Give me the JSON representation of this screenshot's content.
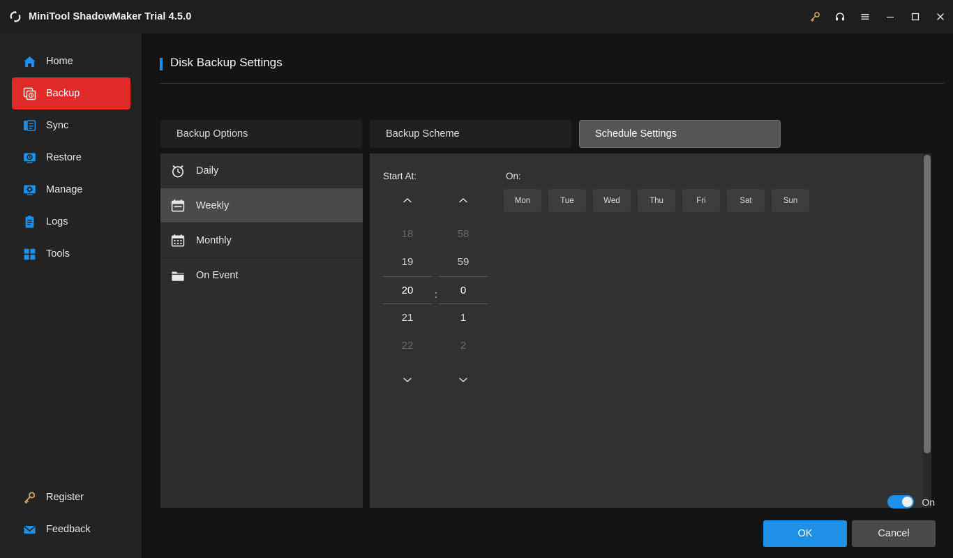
{
  "window": {
    "title": "MiniTool ShadowMaker Trial 4.5.0",
    "logo_icon": "shadowmaker-logo-icon",
    "controls": [
      {
        "name": "key-icon",
        "label": ""
      },
      {
        "name": "headset-icon",
        "label": ""
      },
      {
        "name": "menu-icon",
        "label": ""
      },
      {
        "name": "minimize-icon",
        "label": ""
      },
      {
        "name": "maximize-icon",
        "label": ""
      },
      {
        "name": "close-icon",
        "label": ""
      }
    ]
  },
  "sidebar": {
    "items": [
      {
        "label": "Home",
        "icon": "home-icon",
        "active": false
      },
      {
        "label": "Backup",
        "icon": "backup-icon",
        "active": true
      },
      {
        "label": "Sync",
        "icon": "sync-icon",
        "active": false
      },
      {
        "label": "Restore",
        "icon": "restore-icon",
        "active": false
      },
      {
        "label": "Manage",
        "icon": "manage-icon",
        "active": false
      },
      {
        "label": "Logs",
        "icon": "logs-icon",
        "active": false
      },
      {
        "label": "Tools",
        "icon": "tools-icon",
        "active": false
      }
    ],
    "bottom_items": [
      {
        "label": "Register",
        "icon": "key-icon"
      },
      {
        "label": "Feedback",
        "icon": "envelope-icon"
      }
    ]
  },
  "page": {
    "title": "Disk Backup Settings",
    "accent_color": "#1e90e8"
  },
  "tabs": [
    {
      "label": "Backup Options",
      "active": false
    },
    {
      "label": "Backup Scheme",
      "active": false
    },
    {
      "label": "Schedule Settings",
      "active": true
    }
  ],
  "schedule_list": [
    {
      "label": "Daily",
      "icon": "alarm-clock-icon",
      "selected": false
    },
    {
      "label": "Weekly",
      "icon": "calendar-icon",
      "selected": true
    },
    {
      "label": "Monthly",
      "icon": "calendar-grid-icon",
      "selected": false
    },
    {
      "label": "On Event",
      "icon": "folder-icon",
      "selected": false
    }
  ],
  "detail": {
    "start_at_label": "Start At:",
    "on_label": "On:",
    "time_separator": ":",
    "hours": [
      {
        "value": "18",
        "state": "dim"
      },
      {
        "value": "19",
        "state": "normal"
      },
      {
        "value": "20",
        "state": "selected"
      },
      {
        "value": "21",
        "state": "normal"
      },
      {
        "value": "22",
        "state": "dim"
      }
    ],
    "minutes": [
      {
        "value": "58",
        "state": "dim"
      },
      {
        "value": "59",
        "state": "normal"
      },
      {
        "value": "0",
        "state": "selected"
      },
      {
        "value": "1",
        "state": "normal"
      },
      {
        "value": "2",
        "state": "dim"
      }
    ],
    "selected_hour": "20",
    "selected_minute": "0",
    "days": [
      {
        "label": "Mon",
        "selected": false
      },
      {
        "label": "Tue",
        "selected": false
      },
      {
        "label": "Wed",
        "selected": false
      },
      {
        "label": "Thu",
        "selected": false
      },
      {
        "label": "Fri",
        "selected": false
      },
      {
        "label": "Sat",
        "selected": false
      },
      {
        "label": "Sun",
        "selected": false
      }
    ]
  },
  "footer": {
    "toggle_label": "On",
    "toggle_state": "on",
    "toggle_color": "#1e90e8",
    "ok_label": "OK",
    "cancel_label": "Cancel"
  }
}
